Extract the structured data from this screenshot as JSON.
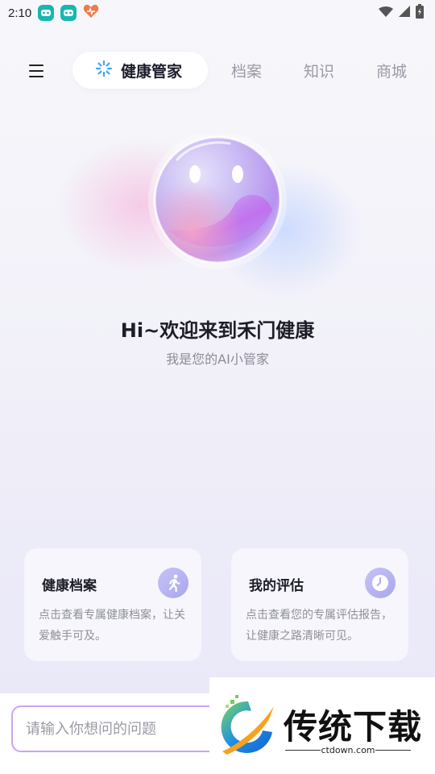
{
  "status_bar": {
    "time": "2:10",
    "icons": [
      "app-notification-icon",
      "app-notification-icon",
      "heart-app-icon",
      "wifi-icon",
      "signal-icon",
      "battery-icon"
    ]
  },
  "nav": {
    "menu_icon": "hamburger-menu-icon",
    "active_tab": "健康管家",
    "tabs": [
      "档案",
      "知识",
      "商城"
    ]
  },
  "hero": {
    "greeting": "Hi~欢迎来到禾门健康",
    "subtitle": "我是您的AI小管家"
  },
  "cards": [
    {
      "title": "健康档案",
      "description": "点击查看专属健康档案，让关爱触手可及。",
      "icon": "running-person-icon"
    },
    {
      "title": "我的评估",
      "description": "点击查看您的专属评估报告，让健康之路清晰可见。",
      "icon": "clock-icon"
    }
  ],
  "chat_input": {
    "placeholder": "请输入你想问的问题"
  },
  "watermark": {
    "brand": "传统下载",
    "url": "ctdown.com"
  },
  "colors": {
    "accent_purple": "#c9a6ee",
    "app_badge": "#16b7b0",
    "card_icon": "#b6b2f2"
  }
}
